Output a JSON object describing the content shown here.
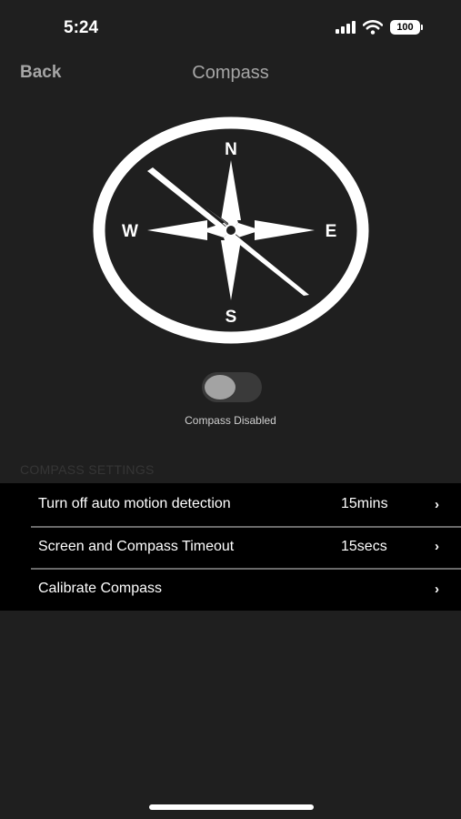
{
  "status_bar": {
    "time": "5:24",
    "battery": "100",
    "icons": [
      "cellular-signal-icon",
      "wifi-icon",
      "battery-icon"
    ]
  },
  "nav": {
    "back_label": "Back",
    "title": "Compass"
  },
  "compass": {
    "north": "N",
    "south": "S",
    "east": "E",
    "west": "W",
    "icon": "compass-rose-icon"
  },
  "toggle": {
    "state": "off",
    "caption": "Compass Disabled"
  },
  "settings": {
    "header": "COMPASS SETTINGS",
    "rows": [
      {
        "label": "Turn off auto motion detection",
        "value": "15mins",
        "chevron": "›"
      },
      {
        "label": "Screen and Compass Timeout",
        "value": "15secs",
        "chevron": "›"
      },
      {
        "label": "Calibrate Compass",
        "value": "",
        "chevron": "›"
      }
    ]
  },
  "colors": {
    "background": "#1f1f1f",
    "list_background": "#000000",
    "muted_text": "#a6a6a6",
    "toggle_track": "#3a3a3a",
    "toggle_knob": "#a3a3a3"
  }
}
